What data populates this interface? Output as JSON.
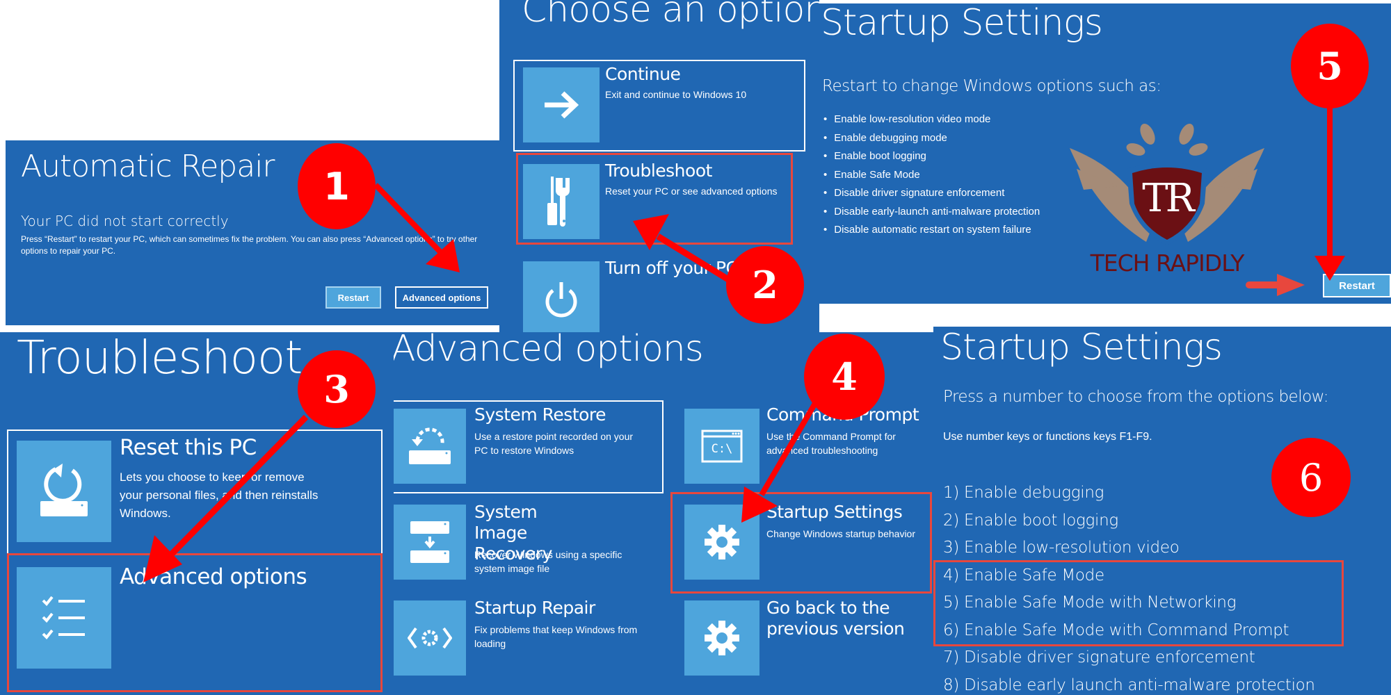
{
  "colors": {
    "panel_blue": "#2067b3",
    "tile_blue": "#4ea5dc",
    "badge_red": "#ff0000",
    "highlight_red": "#e8473d",
    "logo_maroon": "#6b1014",
    "logo_tan": "#a58b77"
  },
  "automatic_repair": {
    "title": "Automatic Repair",
    "subtitle": "Your PC did not start correctly",
    "body": "Press “Restart” to restart your PC, which can sometimes fix the problem. You can also press “Advanced options” to try other options to repair your PC.",
    "restart_label": "Restart",
    "advanced_label": "Advanced options"
  },
  "choose_option": {
    "title": "Choose an option",
    "items": [
      {
        "title": "Continue",
        "desc": "Exit and continue to Windows 10",
        "icon": "arrow-right-icon"
      },
      {
        "title": "Troubleshoot",
        "desc": "Reset your PC or see advanced options",
        "icon": "tools-icon"
      },
      {
        "title": "Turn off your PC",
        "desc": "",
        "icon": "power-icon"
      }
    ]
  },
  "startup_settings_restart": {
    "title": "Startup Settings",
    "subtitle": "Restart to change Windows options such as:",
    "bullets": [
      "Enable low-resolution video mode",
      "Enable debugging mode",
      "Enable boot logging",
      "Enable Safe Mode",
      "Disable driver signature enforcement",
      "Disable early-launch anti-malware protection",
      "Disable automatic restart on system failure"
    ],
    "restart_label": "Restart"
  },
  "logo": {
    "monogram": "TR",
    "brand": "TECH RAPIDLY"
  },
  "troubleshoot": {
    "title": "Troubleshoot",
    "items": [
      {
        "title": "Reset this PC",
        "desc": "Lets you choose to keep or remove your personal files, and then reinstalls Windows.",
        "icon": "reset-icon"
      },
      {
        "title": "Advanced options",
        "desc": "",
        "icon": "checklist-icon"
      }
    ]
  },
  "advanced_options": {
    "title": "Advanced options",
    "items": [
      {
        "title": "System Restore",
        "desc": "Use a restore point recorded on your PC to restore Windows",
        "icon": "system-restore-icon"
      },
      {
        "title": "Command Prompt",
        "desc": "Use the Command Prompt for advanced troubleshooting",
        "icon": "command-prompt-icon"
      },
      {
        "title": "System Image Recovery",
        "desc": "Recover Windows using a specific system image file",
        "icon": "image-recovery-icon"
      },
      {
        "title": "Startup Settings",
        "desc": "Change Windows startup behavior",
        "icon": "gear-icon"
      },
      {
        "title": "Startup Repair",
        "desc": "Fix problems that keep Windows from loading",
        "icon": "startup-repair-icon"
      },
      {
        "title": "Go back to the previous version",
        "desc": "",
        "icon": "gear-icon"
      }
    ],
    "cmd_glyph": "C:\\"
  },
  "startup_settings_menu": {
    "title": "Startup Settings",
    "instruction": "Press a number to choose from the options below:",
    "hint": "Use number keys or functions keys F1-F9.",
    "options": [
      "1) Enable debugging",
      "2) Enable boot logging",
      "3) Enable low-resolution video",
      "4) Enable Safe Mode",
      "5) Enable Safe Mode with Networking",
      "6) Enable Safe Mode with Command Prompt",
      "7) Disable driver signature enforcement",
      "8) Disable early launch anti-malware protection"
    ]
  },
  "steps": [
    "1",
    "2",
    "3",
    "4",
    "5",
    "6"
  ]
}
